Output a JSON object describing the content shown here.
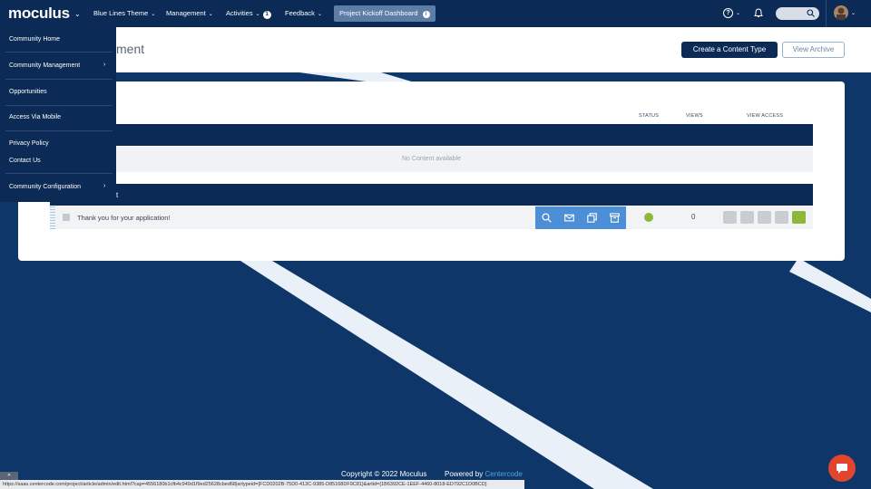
{
  "brand": {
    "logo": "moculus"
  },
  "nav": {
    "items": [
      {
        "label": "Blue Lines Theme"
      },
      {
        "label": "Management"
      },
      {
        "label": "Activities",
        "badge": "1"
      },
      {
        "label": "Feedback"
      }
    ],
    "active_tab": "Project Kickoff Dashboard"
  },
  "header": {
    "title_partial": "ment",
    "primary_button": "Create a Content Type",
    "secondary_button": "View Archive"
  },
  "table": {
    "columns": {
      "status": "STATUS",
      "views": "VIEWS",
      "view_access": "VIEW ACCESS"
    },
    "empty_text": "No Content available",
    "section2_label_partial": "t",
    "rows": [
      {
        "title": "Thank you for your application!",
        "views": "0",
        "status_color": "#8db83a"
      }
    ]
  },
  "menu": {
    "items": [
      {
        "label": "Community Home",
        "has_submenu": false
      },
      {
        "label": "Community Management",
        "has_submenu": true
      },
      {
        "label": "Opportunities",
        "has_submenu": false
      },
      {
        "label": "Access Via Mobile",
        "has_submenu": false
      },
      {
        "label": "Privacy Policy",
        "has_submenu": false
      },
      {
        "label": "Contact Us",
        "has_submenu": false
      },
      {
        "label": "Community Configuration",
        "has_submenu": true
      }
    ]
  },
  "footer": {
    "copyright": "Copyright © 2022 Moculus",
    "powered_by": "Powered by",
    "powered_link": "Centercode"
  },
  "statusbar": {
    "url": "https://saas.centercode.com/project/article/admin/edit.html?cap=4556180b1cfb4c949d1f9ed25628cbed68|artypeid={FCD0202B-75D0-413C-9385-D85168DF9C81}&artid={1B6392CE-1EEF-4460-8018-ED792C1D0BCD}"
  },
  "colors": {
    "nav_bg": "#0b2a55",
    "accent": "#4d8fd6",
    "status_green": "#8db83a",
    "chat": "#e0452e"
  }
}
